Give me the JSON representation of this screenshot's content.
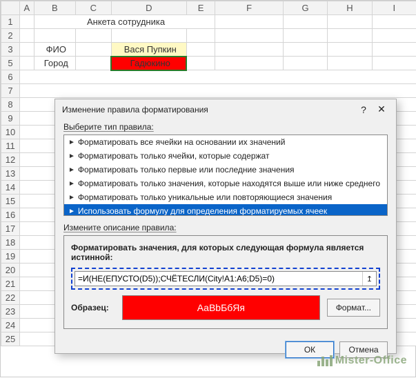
{
  "columns": [
    "A",
    "B",
    "C",
    "D",
    "E",
    "F",
    "G",
    "H",
    "I"
  ],
  "rows": [
    "1",
    "2",
    "3",
    "5",
    "6",
    "7",
    "8",
    "9",
    "10",
    "11",
    "12",
    "13",
    "14",
    "15",
    "16",
    "17",
    "18",
    "19",
    "20",
    "21",
    "22",
    "23",
    "24",
    "25"
  ],
  "cells": {
    "title": "Анкета сотрудника",
    "b3": "ФИО",
    "d3": "Вася Пупкин",
    "b5": "Город",
    "d5": "Гадюкино"
  },
  "dialog": {
    "title": "Изменение правила форматирования",
    "help": "?",
    "close": "✕",
    "section1": "Выберите тип правила:",
    "rules": [
      "Форматировать все ячейки на основании их значений",
      "Форматировать только ячейки, которые содержат",
      "Форматировать только первые или последние значения",
      "Форматировать только значения, которые находятся выше или ниже среднего",
      "Форматировать только уникальные или повторяющиеся значения",
      "Использовать формулу для определения форматируемых ячеек"
    ],
    "selected_rule_index": 5,
    "section2": "Измените описание правила:",
    "formula_label": "Форматировать значения, для которых следующая формула является истинной:",
    "formula": "=И(НЕ(ЕПУСТО(D5));СЧЁТЕСЛИ(City!A1:A6;D5)=0)",
    "ref_btn": "↥",
    "sample_label": "Образец:",
    "sample_text": "АаВbБбЯя",
    "format_btn": "Формат...",
    "ok": "ОК",
    "cancel": "Отмена"
  },
  "watermark": "Mister-Office"
}
